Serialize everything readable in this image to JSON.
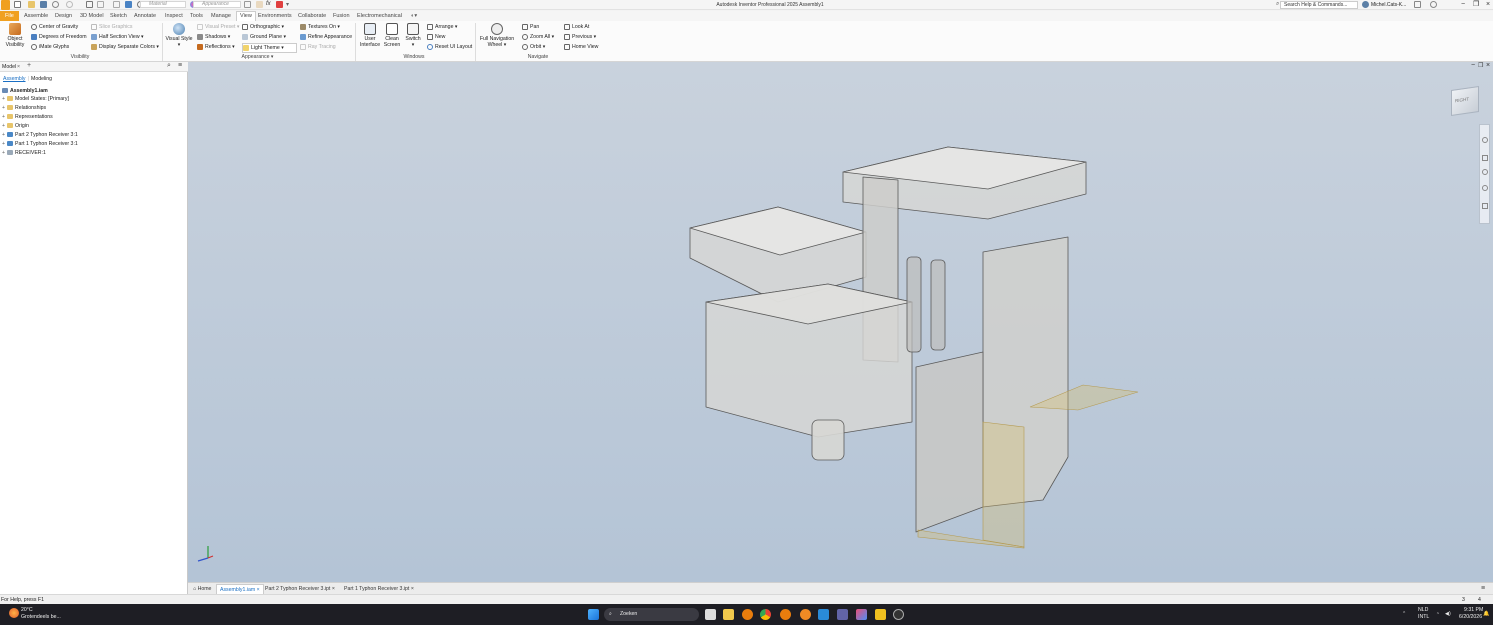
{
  "titlebar": {
    "app_title": "Autodesk Inventor Professional 2025   Assembly1",
    "material_placeholder": "Material",
    "appearance_placeholder": "Appearance",
    "help_search": "Search Help & Commands...",
    "user": "Michel.Cats-K...",
    "icons": [
      "app-logo-icon",
      "new-icon",
      "open-icon",
      "save-icon",
      "undo-icon",
      "redo-icon",
      "home-icon",
      "return-icon",
      "update-icon",
      "select-icon",
      "material-icon",
      "appearance-icon",
      "clear-icon",
      "fx-icon",
      "measure-icon",
      "close-icon"
    ]
  },
  "tabs": [
    "File",
    "Assemble",
    "Design",
    "3D Model",
    "Sketch",
    "Annotate",
    "Inspect",
    "Tools",
    "Manage",
    "View",
    "Environments",
    "Collaborate",
    "Fusion",
    "Electromechanical"
  ],
  "active_tab": "View",
  "ribbon": {
    "visibility": {
      "object_visibility": "Object Visibility",
      "center_of_gravity": "Center of Gravity",
      "degrees_of_freedom": "Degrees of Freedom",
      "imate_glyphs": "iMate Glyphs",
      "slice_graphics": "Slice Graphics",
      "half_section_view": "Half Section View",
      "display_separate_colors": "Display Separate Colors",
      "label": "Visibility"
    },
    "appearance": {
      "visual_style": "Visual Style",
      "visual_preset": "Visual Preset",
      "orthographic": "Orthographic",
      "textures_on": "Textures On",
      "shadows": "Shadows",
      "ground_plane": "Ground Plane",
      "refine_appearance": "Refine Appearance",
      "reflections": "Reflections",
      "light_theme": "Light Theme",
      "ray_tracing": "Ray Tracing",
      "label": "Appearance"
    },
    "windows": {
      "user_interface": "User Interface",
      "clean_screen": "Clean Screen",
      "switch": "Switch",
      "arrange": "Arrange",
      "new": "New",
      "reset_ui_layout": "Reset UI Layout",
      "label": "Windows"
    },
    "navigate": {
      "full_nav_wheel": "Full Navigation Wheel",
      "pan": "Pan",
      "zoom_all": "Zoom All",
      "orbit": "Orbit",
      "look_at": "Look At",
      "previous": "Previous",
      "home_view": "Home View",
      "label": "Navigate"
    }
  },
  "browser": {
    "title": "Model",
    "tabs": [
      "Assembly",
      "Modeling"
    ],
    "tree": [
      "Assembly1.iam",
      "Model States: [Primary]",
      "Relationships",
      "Representations",
      "Origin",
      "Part 2 Typhon Receiver 3:1",
      "Part 1 Typhon Receiver 3:1",
      "RECEIVER:1"
    ]
  },
  "viewcube": {
    "face": "RIGHT"
  },
  "doc_tabs": [
    "Home",
    "Assembly1.iam",
    "Part 2 Typhon Receiver 3.ipt",
    "Part 1 Typhon Receiver 3.ipt"
  ],
  "status": {
    "help": "For Help, press F1",
    "count_a": "3",
    "count_b": "4"
  },
  "taskbar": {
    "weather_temp": "20°C",
    "weather_desc": "Grotendeels be...",
    "search": "Zoeken",
    "lang1": "NLD",
    "lang2": "INTL",
    "time": "9:31 PM",
    "date": "6/20/2026"
  },
  "colors": {
    "accent": "#1a6fc4",
    "file_tab": "#f0a020",
    "viewport_top": "#c9d2dd",
    "viewport_bottom": "#b4c4d6",
    "taskbar": "#1e1e24"
  }
}
